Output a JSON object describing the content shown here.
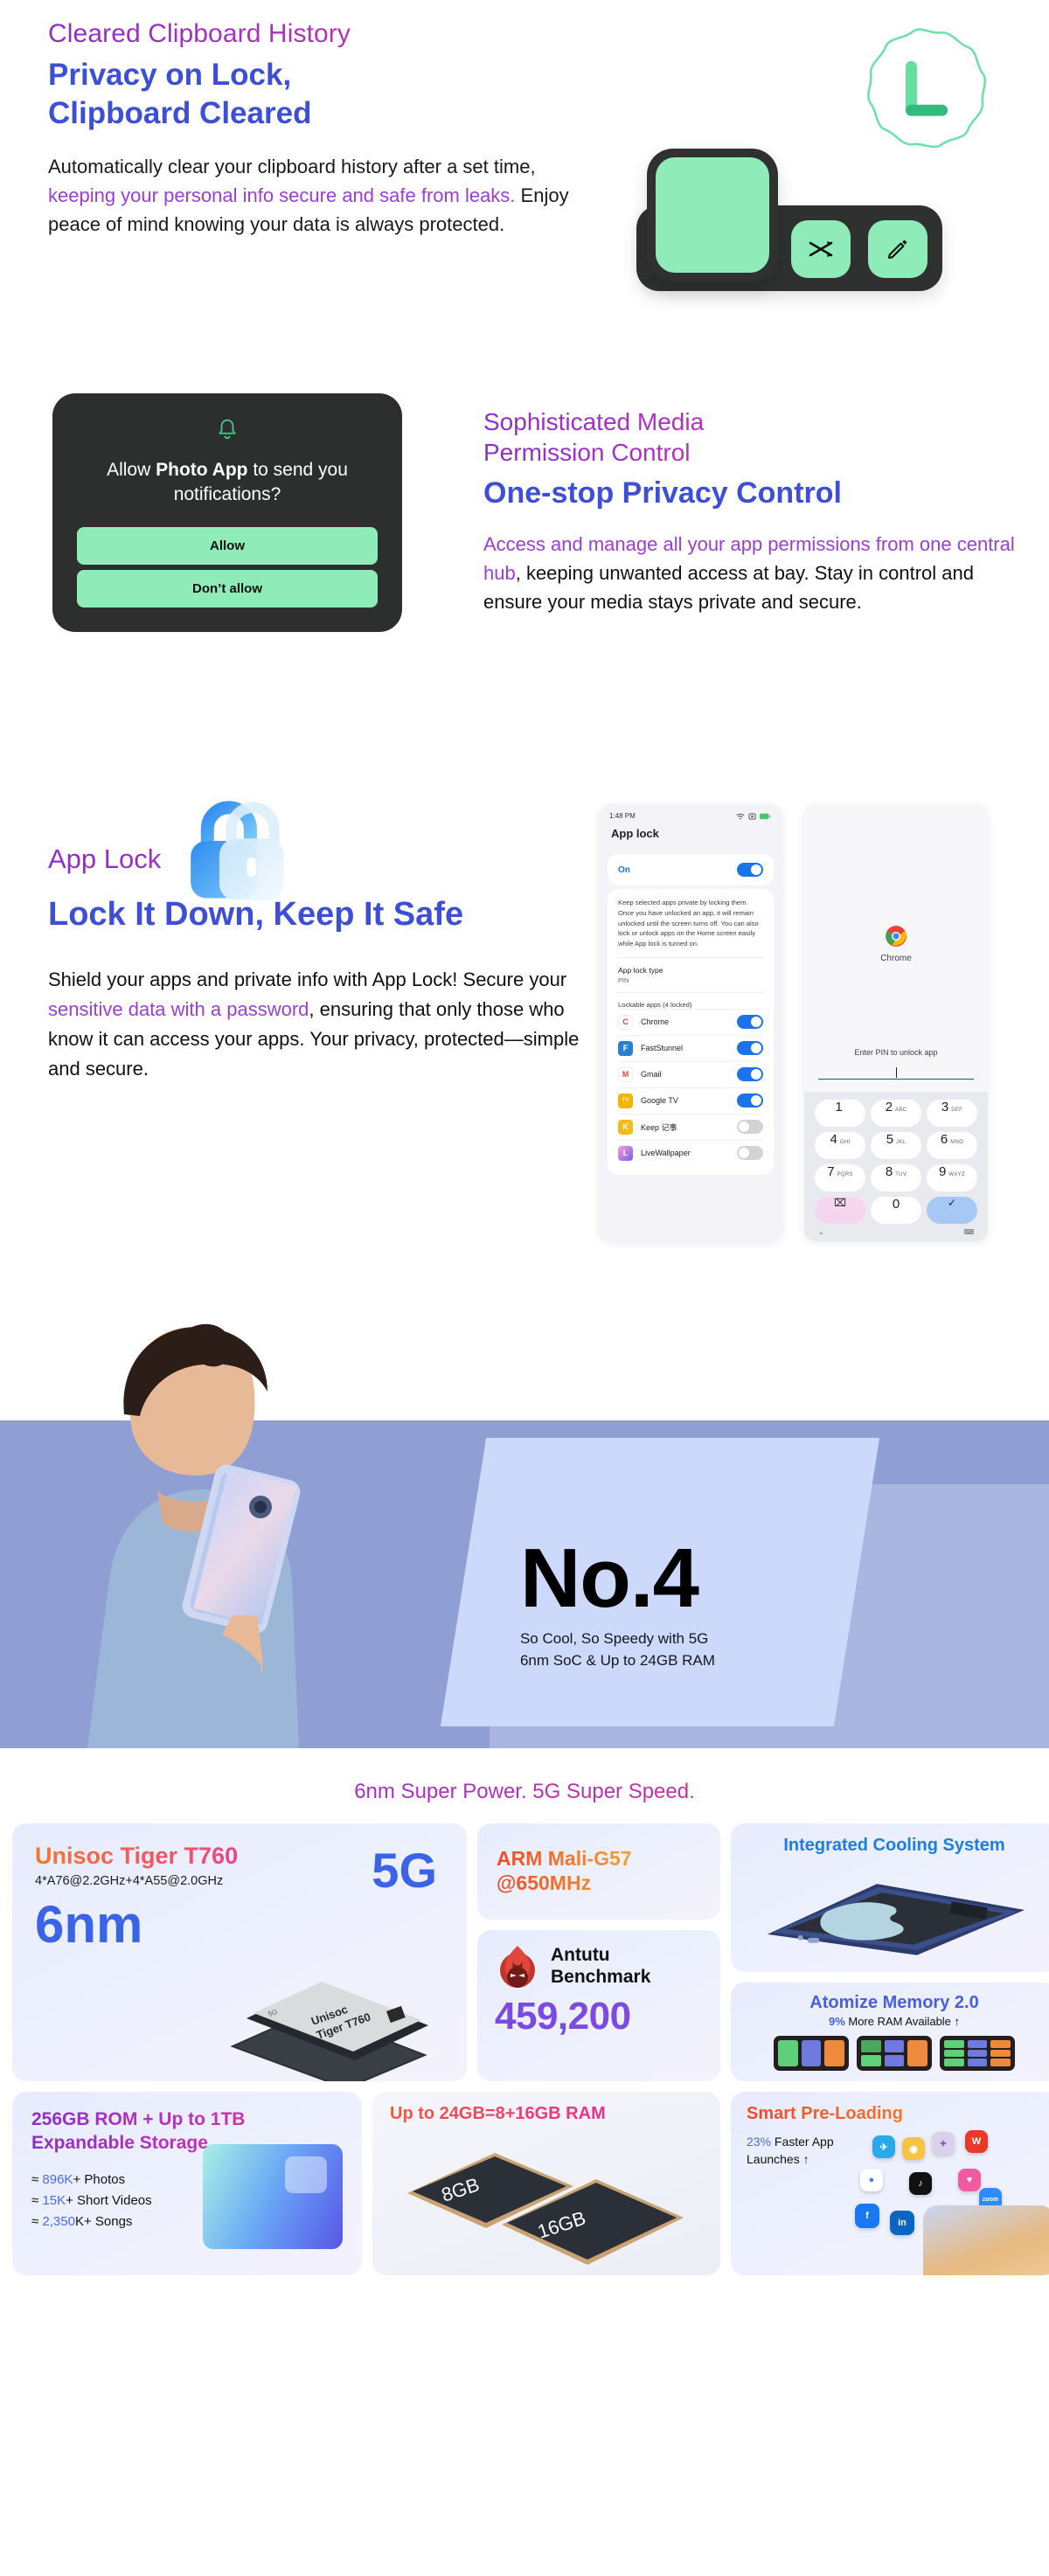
{
  "section1": {
    "eyebrow": "Cleared Clipboard History",
    "heading_line1": "Privacy on Lock,",
    "heading_line2": "Clipboard Cleared",
    "body_before": "Automatically clear your clipboard history after a set time, ",
    "body_highlight": "keeping your personal info secure and safe from leaks.",
    "body_after": " Enjoy peace of mind knowing your data is always protected."
  },
  "section2": {
    "dialog": {
      "icon": "bell-icon",
      "question_before": "Allow ",
      "question_app": "Photo App",
      "question_after": " to send you notifications?",
      "allow_label": "Allow",
      "deny_label": "Don’t allow"
    },
    "eyebrow_line1": "Sophisticated Media",
    "eyebrow_line2": "Permission Control",
    "heading": "One-stop Privacy Control",
    "body_highlight": "Access and manage all your app permissions from one central hub",
    "body_after": ", keeping unwanted access at bay. Stay in control and ensure your media stays private and secure."
  },
  "section3": {
    "eyebrow": "App Lock",
    "heading": "Lock It Down, Keep It Safe",
    "body_before": "Shield your apps and private info with App Lock! Secure your ",
    "body_highlight": "sensitive data with a password",
    "body_after": ", ensuring that only those who know it can access your apps. Your privacy, protected—simple and secure.",
    "phone_applock": {
      "status_time": "1:48 PM",
      "title": "App lock",
      "toggle_label": "On",
      "toggle_state": "on",
      "description": "Keep selected apps private by locking them. Once you have unlocked an app, it will remain unlocked until the screen turns off. You can also lock or unlock apps on the Home screen easily while App lock is turned on.",
      "type_label": "App lock type",
      "type_value": "PIN",
      "list_label": "Lockable apps (4 locked)",
      "apps": [
        {
          "name": "Chrome",
          "state": "on",
          "color": "#ea4335",
          "glyph": "C"
        },
        {
          "name": "FastStunnel",
          "state": "on",
          "color": "#2a7fd4",
          "glyph": "F"
        },
        {
          "name": "Gmail",
          "state": "on",
          "color": "#ea4335",
          "glyph": "M"
        },
        {
          "name": "Google TV",
          "state": "on",
          "color": "#f4b400",
          "glyph": "TV"
        },
        {
          "name": "Keep 记事",
          "state": "off",
          "color": "#f5bb1d",
          "glyph": "K"
        },
        {
          "name": "LiveWallpaper",
          "state": "off",
          "color": "#d63ab0",
          "glyph": "L"
        }
      ]
    },
    "phone_pin": {
      "app_name": "Chrome",
      "prompt": "Enter PIN to unlock app",
      "keys": [
        {
          "n": "1",
          "l": ""
        },
        {
          "n": "2",
          "l": "ABC"
        },
        {
          "n": "3",
          "l": "DEF"
        },
        {
          "n": "4",
          "l": "GHI"
        },
        {
          "n": "5",
          "l": "JKL"
        },
        {
          "n": "6",
          "l": "MNO"
        },
        {
          "n": "7",
          "l": "PQRS"
        },
        {
          "n": "8",
          "l": "TUV"
        },
        {
          "n": "9",
          "l": "WXYZ"
        }
      ],
      "delete_glyph": "⌧",
      "zero": "0",
      "confirm_glyph": "✓"
    }
  },
  "hero": {
    "rank": "No.4",
    "sub_line1": "So Cool, So Speedy with 5G",
    "sub_line2": "6nm SoC & Up to 24GB RAM"
  },
  "specs": {
    "title": "6nm Super Power. 5G Super Speed.",
    "cpu": {
      "title": "Unisoc Tiger T760",
      "subtitle": "4*A76@2.2GHz+4*A55@2.0GHz",
      "process": "6nm",
      "network": "5G",
      "chip_label_small": "5G",
      "chip_label_1": "Unisoc",
      "chip_label_2": "Tiger T760"
    },
    "gpu": {
      "title_line1": "ARM Mali-G57",
      "title_line2": "@650MHz"
    },
    "antutu": {
      "name_line1": "Antutu",
      "name_line2": "Benchmark",
      "score": "459,200",
      "icon": "antutu-flame-icon"
    },
    "cooling": {
      "title": "Integrated Cooling System"
    },
    "atomize": {
      "title": "Atomize Memory 2.0",
      "sub_value": "9%",
      "sub_rest": " More RAM Available ↑"
    },
    "rom": {
      "title_line1": "256GB ROM + Up to 1TB",
      "title_line2": "Expandable Storage",
      "items": [
        {
          "approx": "≈ ",
          "value": "896K",
          "rest": "+ Photos"
        },
        {
          "approx": "≈ ",
          "value": "15K",
          "rest": "+ Short Videos"
        },
        {
          "approx": "≈ ",
          "value": "2,350",
          "rest": "K+ Songs"
        }
      ]
    },
    "ram": {
      "title": "Up to 24GB=8+16GB RAM",
      "chip1": "8GB",
      "chip2": "16GB"
    },
    "preloading": {
      "title": "Smart Pre-Loading",
      "sub_value": "23%",
      "sub_rest": " Faster App",
      "sub_line2": "Launches ↑",
      "app_icons": [
        {
          "name": "telegram-icon",
          "glyph": "✈",
          "color": "#29a9eb"
        },
        {
          "name": "game-icon",
          "glyph": "◉",
          "color": "#f6c445"
        },
        {
          "name": "anime-game-icon",
          "glyph": "✦",
          "color": "#d9d2e9"
        },
        {
          "name": "wps-icon",
          "glyph": "W",
          "color": "#e8392b"
        },
        {
          "name": "chrome-icon",
          "glyph": "●",
          "color": "#ffffff"
        },
        {
          "name": "tiktok-icon",
          "glyph": "♪",
          "color": "#111111"
        },
        {
          "name": "girls-game-icon",
          "glyph": "♥",
          "color": "#ef5aa0"
        },
        {
          "name": "facebook-icon",
          "glyph": "f",
          "color": "#1877f2"
        },
        {
          "name": "linkedin-icon",
          "glyph": "in",
          "color": "#0a66c2"
        },
        {
          "name": "youtube-icon",
          "glyph": "▶",
          "color": "#e8392b"
        },
        {
          "name": "zoom-icon",
          "glyph": "zoom",
          "color": "#2d8cff"
        }
      ]
    }
  }
}
